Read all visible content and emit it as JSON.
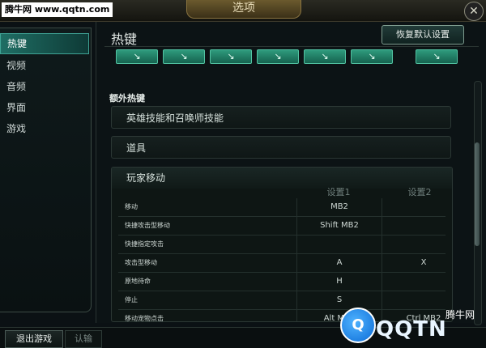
{
  "watermark": "腾牛网 www.qqtn.com",
  "window": {
    "title": "选项"
  },
  "close_icon": "✕",
  "sidebar": {
    "items": [
      {
        "label": "热键",
        "active": true
      },
      {
        "label": "视频",
        "active": false
      },
      {
        "label": "音频",
        "active": false
      },
      {
        "label": "界面",
        "active": false
      },
      {
        "label": "游戏",
        "active": false
      }
    ]
  },
  "panel": {
    "title": "热键",
    "reset_label": "恢复默认设置",
    "extra_heading": "额外热键",
    "categories": [
      {
        "label": "英雄技能和召唤师技能"
      },
      {
        "label": "道具"
      }
    ],
    "player_move": {
      "label": "玩家移动",
      "col1": "设置1",
      "col2": "设置2",
      "rows": [
        {
          "name": "移动",
          "v1": "MB2",
          "v2": ""
        },
        {
          "name": "快捷攻击型移动",
          "v1": "Shift  MB2",
          "v2": ""
        },
        {
          "name": "快捷指定攻击",
          "v1": "",
          "v2": ""
        },
        {
          "name": "攻击型移动",
          "v1": "A",
          "v2": "X"
        },
        {
          "name": "原地待命",
          "v1": "H",
          "v2": ""
        },
        {
          "name": "停止",
          "v1": "S",
          "v2": ""
        },
        {
          "name": "移动宠物点击",
          "v1": "Alt  MB2",
          "v2": "Ctrl  MB2"
        }
      ]
    }
  },
  "bottom": {
    "exit_label": "退出游戏",
    "surrender_label": "认输"
  },
  "logo": {
    "mark": "Q",
    "text": "QQTN",
    "sub": "腾牛网"
  }
}
